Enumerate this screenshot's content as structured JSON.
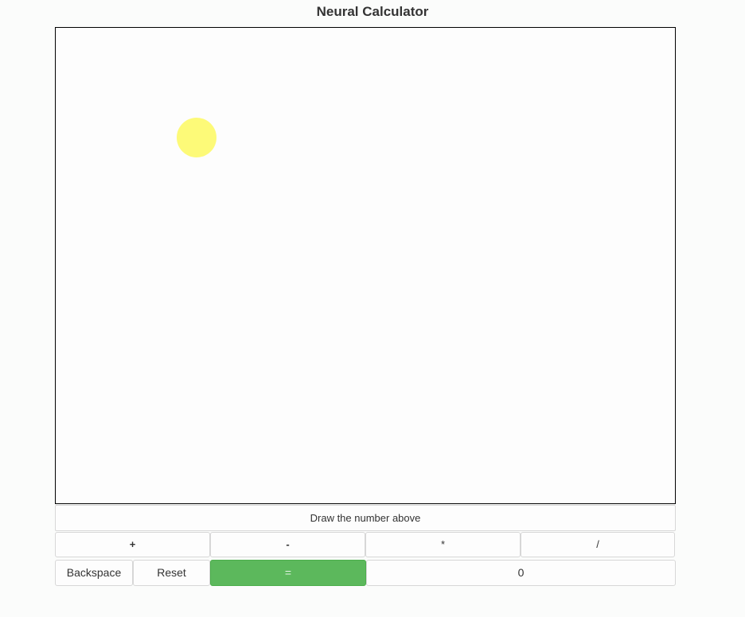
{
  "app": {
    "title": "Neural Calculator"
  },
  "status": {
    "message": "Draw the number above"
  },
  "operators": [
    "+",
    "-",
    "*",
    "/"
  ],
  "controls": {
    "backspace_label": "Backspace",
    "reset_label": "Reset",
    "equals_label": "="
  },
  "display": {
    "result": "0"
  },
  "colors": {
    "equals_button": "#5cb85c",
    "cursor_dot": "#fdfa78"
  }
}
